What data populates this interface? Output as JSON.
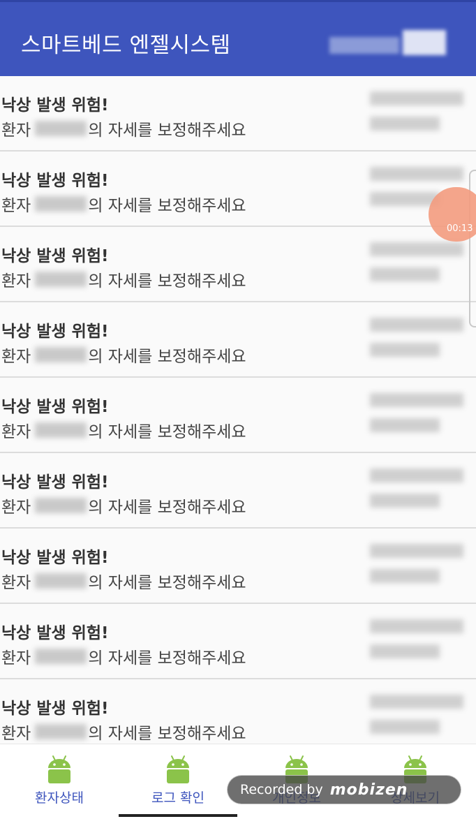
{
  "app_bar": {
    "title": "스마트베드 엔젤시스템"
  },
  "alerts": [
    {
      "title": "낙상 발생 위험!",
      "prefix": "환자",
      "suffix": "의 자세를 보정해주세요"
    },
    {
      "title": "낙상 발생 위험!",
      "prefix": "환자",
      "suffix": "의 자세를 보정해주세요"
    },
    {
      "title": "낙상 발생 위험!",
      "prefix": "환자",
      "suffix": "의 자세를 보정해주세요"
    },
    {
      "title": "낙상 발생 위험!",
      "prefix": "환자",
      "suffix": "의 자세를 보정해주세요"
    },
    {
      "title": "낙상 발생 위험!",
      "prefix": "환자",
      "suffix": "의 자세를 보정해주세요"
    },
    {
      "title": "낙상 발생 위험!",
      "prefix": "환자",
      "suffix": "의 자세를 보정해주세요"
    },
    {
      "title": "낙상 발생 위험!",
      "prefix": "환자",
      "suffix": "의 자세를 보정해주세요"
    },
    {
      "title": "낙상 발생 위험!",
      "prefix": "환자",
      "suffix": "의 자세를 보정해주세요"
    },
    {
      "title": "낙상 발생 위험!",
      "prefix": "환자",
      "suffix": "의 자세를 보정해주세요"
    }
  ],
  "recorder": {
    "timer": "00:13",
    "label": "Recorded by",
    "brand": "mobizen"
  },
  "bottom_nav": {
    "active_index": 1,
    "tabs": [
      {
        "label": "환자상태",
        "icon": "android-icon"
      },
      {
        "label": "로그 확인",
        "icon": "android-icon"
      },
      {
        "label": "개인정보",
        "icon": "android-icon"
      },
      {
        "label": "상세보기",
        "icon": "android-icon"
      }
    ]
  },
  "colors": {
    "primary": "#3e55bd",
    "nav_label": "#3e55bd",
    "android_green": "#8bc34a",
    "recorder_orange": "#f39b7e"
  }
}
